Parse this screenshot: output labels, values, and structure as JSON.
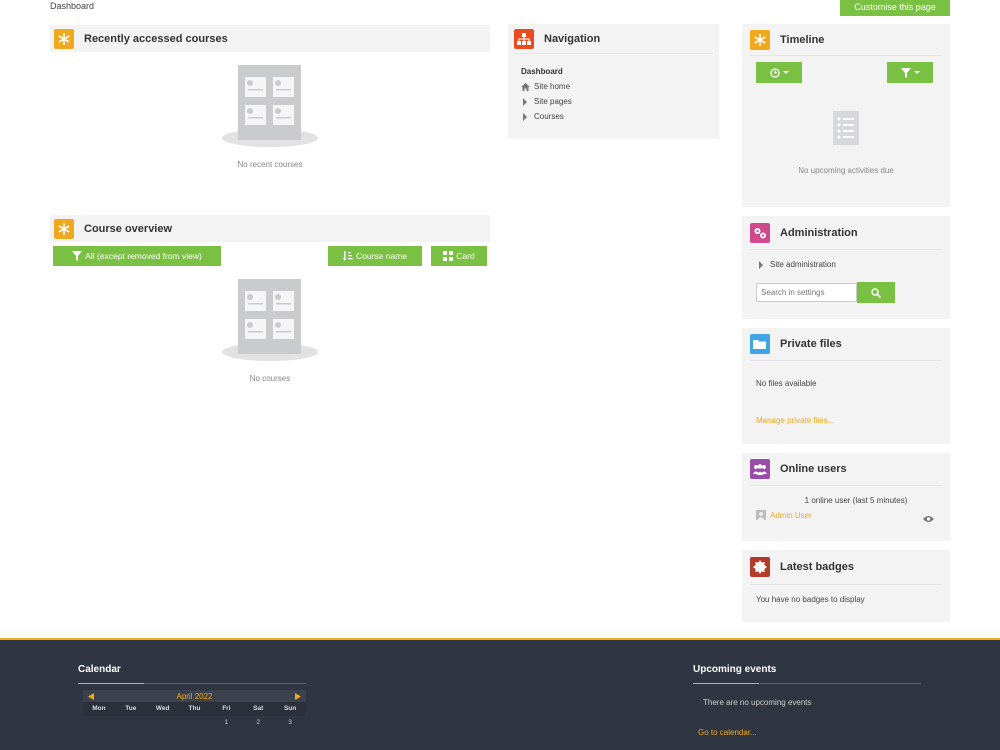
{
  "breadcrumb": "Dashboard",
  "customise_button": "Customise this page",
  "recent": {
    "title": "Recently accessed courses",
    "empty_text": "No recent courses"
  },
  "overview": {
    "title": "Course overview",
    "filter_button": "All (except removed from view)",
    "sort_button": "Course name",
    "view_button": "Card",
    "empty_text": "No courses"
  },
  "navigation": {
    "title": "Navigation",
    "dashboard": "Dashboard",
    "site_home": "Site home",
    "site_pages": "Site pages",
    "courses": "Courses"
  },
  "timeline": {
    "title": "Timeline",
    "empty_text": "No upcoming activities due"
  },
  "administration": {
    "title": "Administration",
    "site_admin": "Site administration",
    "search_placeholder": "Search in settings"
  },
  "private_files": {
    "title": "Private files",
    "empty_text": "No files available",
    "manage_link": "Manage private files..."
  },
  "online_users": {
    "title": "Online users",
    "summary": "1 online user (last 5 minutes)",
    "user": "Admin User"
  },
  "badges": {
    "title": "Latest badges",
    "empty_text": "You have no badges to display"
  },
  "footer": {
    "calendar_title": "Calendar",
    "month": "April 2022",
    "weekdays": [
      "Mon",
      "Tue",
      "Wed",
      "Thu",
      "Fri",
      "Sat",
      "Sun"
    ],
    "first_week": [
      "",
      "",
      "",
      "",
      "1",
      "2",
      "3"
    ],
    "upcoming_title": "Upcoming events",
    "upcoming_empty": "There are no upcoming events",
    "calendar_link": "Go to calendar..."
  },
  "colors": {
    "accent_green": "#7ac143",
    "accent_orange": "#f0a81d",
    "footer_bg": "#2f3541"
  }
}
